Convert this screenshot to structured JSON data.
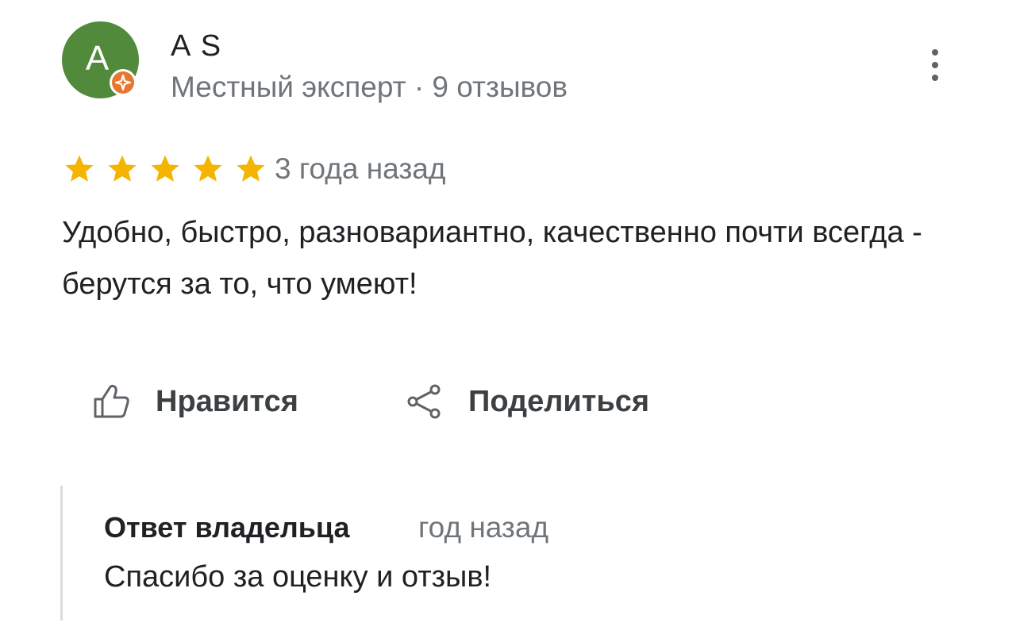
{
  "review": {
    "author": {
      "initial": "A",
      "name": "A S",
      "meta": "Местный эксперт · 9 отзывов",
      "avatar_color": "#518a3a",
      "badge_color": "#e8772e",
      "badge_icon": "local-guide-star-icon"
    },
    "more_icon": "more-vertical-icon",
    "rating": {
      "value": 5,
      "max": 5,
      "star_color": "#f5b400"
    },
    "time_ago": "3 года назад",
    "text": "Удобно, быстро, разновариантно, качественно почти всегда - берутся за то, что умеют!",
    "actions": {
      "like_label": "Нравится",
      "like_icon": "thumbs-up-icon",
      "share_label": "Поделиться",
      "share_icon": "share-icon"
    },
    "owner_reply": {
      "title": "Ответ владельца",
      "time_ago": "год назад",
      "text": "Спасибо за оценку и отзыв!"
    }
  }
}
